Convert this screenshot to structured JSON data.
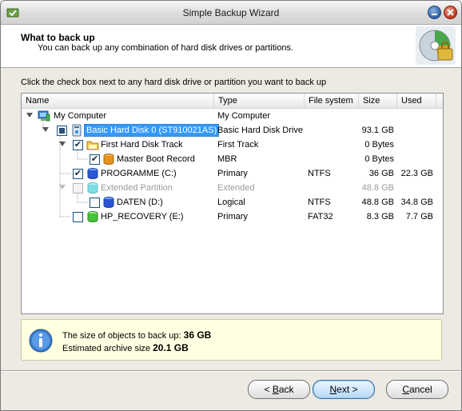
{
  "window": {
    "title": "Simple Backup Wizard"
  },
  "header": {
    "title": "What to back up",
    "subtitle": "You can back up any combination of hard disk drives or partitions."
  },
  "instruction": "Click the check box next to any hard disk drive or partition you want to back up",
  "columns": {
    "name": "Name",
    "type": "Type",
    "fs": "File system",
    "size": "Size",
    "used": "Used"
  },
  "rows": [
    {
      "name": "My Computer",
      "type": "My Computer",
      "fs": "",
      "size": "",
      "used": "",
      "checked": "none",
      "icon": "computer-icon",
      "expanded": true
    },
    {
      "name": "Basic Hard Disk 0 (ST910021AS)",
      "type": "Basic Hard Disk Drive",
      "fs": "",
      "size": "93.1 GB",
      "used": "",
      "checked": "partial",
      "icon": "hard-disk-icon",
      "expanded": true,
      "selected": true
    },
    {
      "name": "First Hard Disk Track",
      "type": "First Track",
      "fs": "",
      "size": "0 Bytes",
      "used": "",
      "checked": "checked",
      "icon": "folder-icon",
      "expanded": true
    },
    {
      "name": "Master Boot Record",
      "type": "MBR",
      "fs": "",
      "size": "0 Bytes",
      "used": "",
      "checked": "checked",
      "icon": "mbr-icon"
    },
    {
      "name": "PROGRAMME (C:)",
      "type": "Primary",
      "fs": "NTFS",
      "size": "36 GB",
      "used": "22.3 GB",
      "checked": "checked",
      "icon": "partition-blue-icon"
    },
    {
      "name": "Extended Partition",
      "type": "Extended",
      "fs": "",
      "size": "48.8 GB",
      "used": "",
      "checked": "unchecked",
      "icon": "partition-extended-icon",
      "expanded": true,
      "disabled": true
    },
    {
      "name": "DATEN (D:)",
      "type": "Logical",
      "fs": "NTFS",
      "size": "48.8 GB",
      "used": "34.8 GB",
      "checked": "unchecked",
      "icon": "partition-blue-icon"
    },
    {
      "name": "HP_RECOVERY (E:)",
      "type": "Primary",
      "fs": "FAT32",
      "size": "8.3 GB",
      "used": "7.7 GB",
      "checked": "unchecked",
      "icon": "partition-green-icon"
    }
  ],
  "info": {
    "size_label": "The size of objects to back up:",
    "size_value": "36 GB",
    "archive_label": "Estimated archive size",
    "archive_value": "20.1 GB"
  },
  "buttons": {
    "back_prefix": "< ",
    "back_hot": "B",
    "back_rest": "ack",
    "next_hot": "N",
    "next_rest": "ext >",
    "cancel_hot": "C",
    "cancel_rest": "ancel"
  }
}
